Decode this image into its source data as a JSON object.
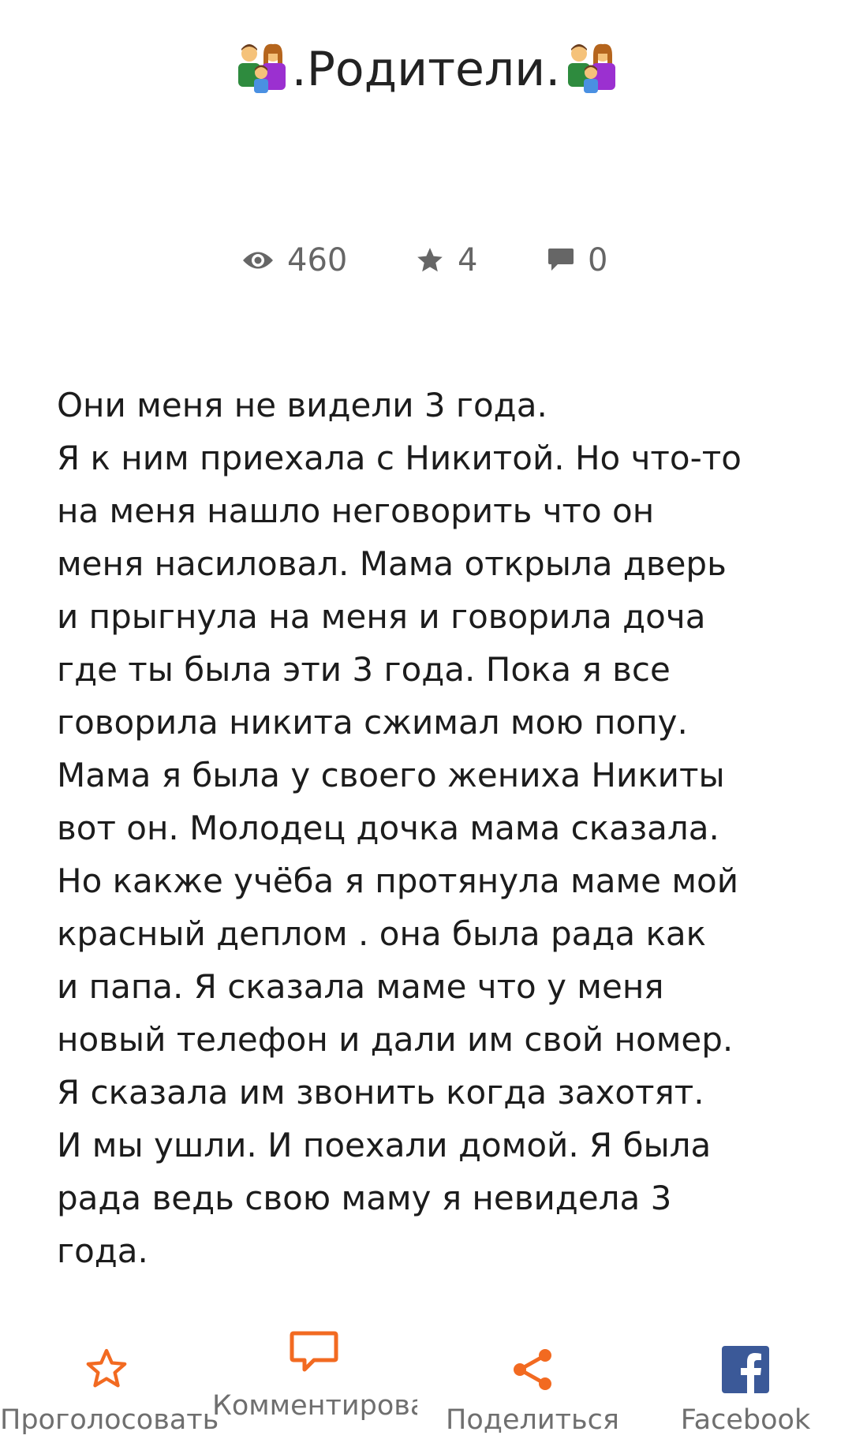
{
  "story": {
    "title": ".Родители.",
    "title_emoji": "family-emoji",
    "stats": {
      "views_icon": "eye-icon",
      "views": "460",
      "votes_icon": "star-icon",
      "votes": "4",
      "comments_icon": "comment-icon",
      "comments": "0"
    },
    "lines": [
      "Они меня не видели 3 года.",
      "Я к ним приехала с Никитой. Но что-то",
      "на меня нашло неговорить что он",
      "меня насиловал. Мама открыла дверь",
      "и прыгнула на меня и говорила доча",
      "где ты была эти 3 года. Пока я все",
      "говорила никита сжимал мою попу.",
      "Мама я была у своего жениха Никиты",
      "вот он. Молодец дочка мама сказала.",
      "Но какже учёба я протянула маме мой",
      "красный деплом . она была рада как",
      "и папа. Я сказала маме что у меня",
      "новый телефон и дали им свой номер.",
      "Я сказала им звонить когда захотят.",
      "И мы ушли. И поехали домой. Я была",
      "рада ведь свою маму я невидела 3",
      "года."
    ]
  },
  "actions": {
    "vote": {
      "label": "Проголосовать",
      "icon": "star-outline-icon"
    },
    "comment": {
      "label": "Комментировать",
      "icon": "comment-outline-icon"
    },
    "share": {
      "label": "Поделиться",
      "icon": "share-icon"
    },
    "facebook": {
      "label": "Facebook",
      "icon": "facebook-icon"
    }
  },
  "colors": {
    "accent": "#f26a21",
    "facebook": "#3b5998",
    "meta_gray": "#666666"
  }
}
